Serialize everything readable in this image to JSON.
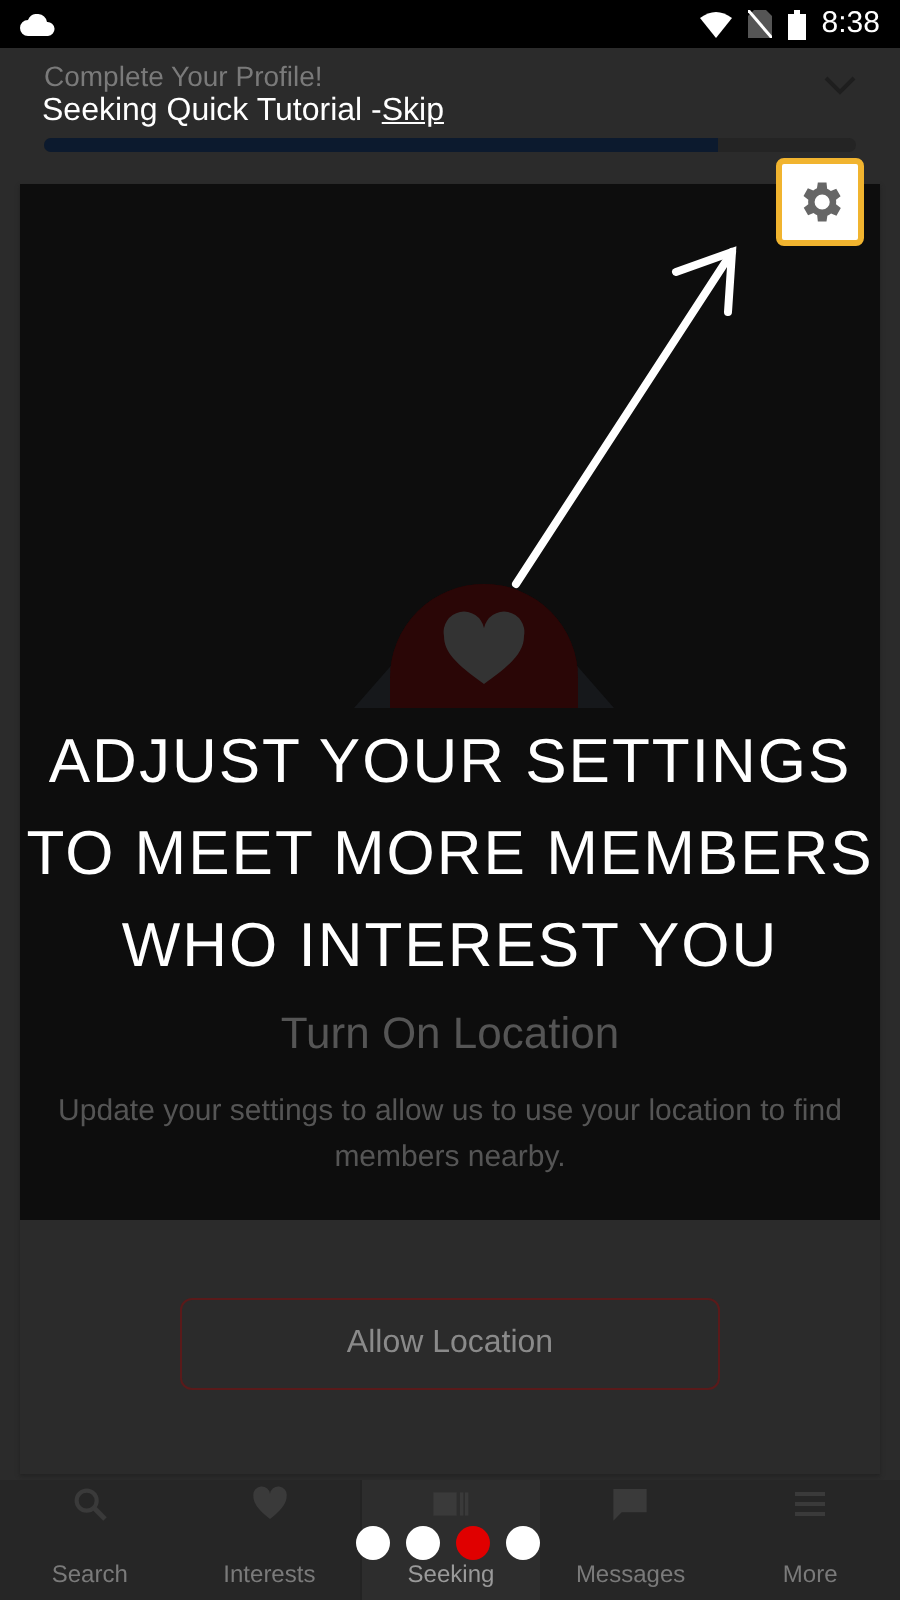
{
  "status_bar": {
    "time": "8:38"
  },
  "header": {
    "title": "Complete Your Profile!",
    "progress": {
      "level": 0.83
    }
  },
  "tutorial": {
    "title": "Seeking Quick Tutorial -",
    "skip": "Skip",
    "message": "ADJUST YOUR SETTINGS\nTO MEET MORE MEMBERS\nWHO INTEREST YOU",
    "steps": [
      {
        "selected": false
      },
      {
        "selected": false
      },
      {
        "selected": true
      },
      {
        "selected": false
      }
    ]
  },
  "location_card": {
    "title": "Turn On Location",
    "description": "Update your settings to allow us to use your location to find members nearby.",
    "button": "Allow Location"
  },
  "bottom_nav": [
    {
      "label": "Search",
      "selected": false
    },
    {
      "label": "Interests",
      "selected": false
    },
    {
      "label": "Seeking",
      "selected": true
    },
    {
      "label": "Messages",
      "selected": false
    },
    {
      "label": "More",
      "selected": false
    }
  ]
}
